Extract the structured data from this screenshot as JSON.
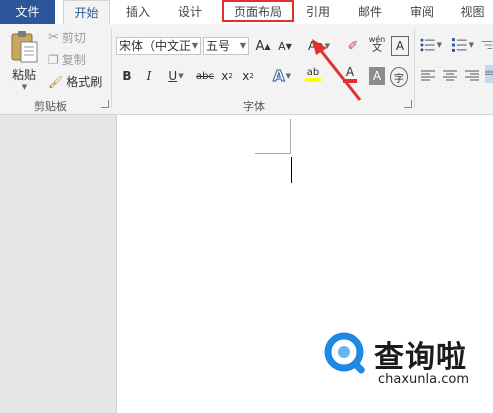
{
  "tabs": {
    "file": "文件",
    "home": "开始",
    "insert": "插入",
    "design": "设计",
    "layout": "页面布局",
    "references": "引用",
    "mailings": "邮件",
    "review": "审阅",
    "view": "视图"
  },
  "clipboard": {
    "paste": "粘贴",
    "cut": "剪切",
    "copy": "复制",
    "format_painter": "格式刷",
    "group_label": "剪贴板"
  },
  "font": {
    "font_name": "宋体（中文正",
    "font_size": "五号",
    "group_label": "字体",
    "grow": "A",
    "shrink": "A",
    "change_case": "Aa",
    "phonetic_top": "wén",
    "phonetic_bottom": "文",
    "char_border": "A",
    "bold": "B",
    "italic": "I",
    "underline": "U",
    "strikethrough": "abc",
    "subscript": "x",
    "subscript_sub": "2",
    "superscript": "x",
    "superscript_sup": "2",
    "text_effects": "A",
    "highlight": "ab",
    "font_color": "A",
    "char_shading": "A",
    "enclose": "字"
  },
  "colors": {
    "accent": "#2b579a",
    "highlight_box": "#e0302f",
    "arrow": "#e0302f",
    "font_color_bar": "#e0302f",
    "highlight_bar": "#ffff00",
    "watermark_blue": "#1e88e5"
  },
  "watermark": {
    "brand": "查询啦",
    "url": "chaxunla.com"
  }
}
